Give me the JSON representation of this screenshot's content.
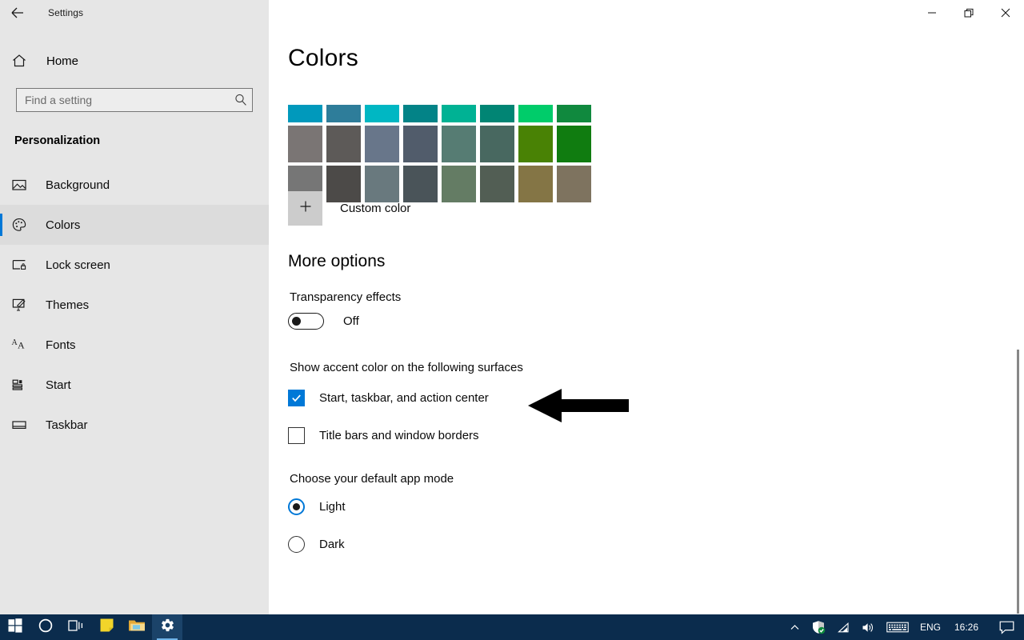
{
  "window": {
    "title": "Settings",
    "back_icon": "back-arrow-icon",
    "controls": [
      {
        "name": "minimize",
        "label": "Minimize"
      },
      {
        "name": "restore",
        "label": "Restore"
      },
      {
        "name": "close",
        "label": "Close"
      }
    ]
  },
  "sidebar": {
    "home_label": "Home",
    "home_icon": "home-icon",
    "search": {
      "placeholder": "Find a setting",
      "value": "",
      "icon": "search-icon"
    },
    "category": "Personalization",
    "items": [
      {
        "label": "Background",
        "icon": "picture-icon",
        "selected": false
      },
      {
        "label": "Colors",
        "icon": "palette-icon",
        "selected": true
      },
      {
        "label": "Lock screen",
        "icon": "lock-screen-icon",
        "selected": false
      },
      {
        "label": "Themes",
        "icon": "brush-icon",
        "selected": false
      },
      {
        "label": "Fonts",
        "icon": "font-icon",
        "selected": false
      },
      {
        "label": "Start",
        "icon": "start-tiles-icon",
        "selected": false
      },
      {
        "label": "Taskbar",
        "icon": "taskbar-icon",
        "selected": false
      }
    ]
  },
  "main": {
    "page_title": "Colors",
    "accent_color": "#0078d7",
    "swatch_rows": [
      {
        "clipped": true,
        "colors": [
          "#0099bc",
          "#2e7d9a",
          "#00b7c3",
          "#038387",
          "#00b294",
          "#018574",
          "#00cc6a",
          "#10893e"
        ]
      },
      {
        "clipped": false,
        "colors": [
          "#7a7574",
          "#5d5a58",
          "#68768a",
          "#515c6b",
          "#567c73",
          "#486860",
          "#498205",
          "#107c10"
        ]
      },
      {
        "clipped": false,
        "colors": [
          "#767676",
          "#4c4a48",
          "#69797e",
          "#4a5459",
          "#647c64",
          "#525e54",
          "#847545",
          "#7e735f"
        ]
      }
    ],
    "custom_color": {
      "label": "Custom color",
      "icon": "plus-icon"
    },
    "more_options_heading": "More options",
    "transparency": {
      "label": "Transparency effects",
      "state": "Off",
      "on": false
    },
    "accent_surfaces_label": "Show accent color on the following surfaces",
    "checkboxes": [
      {
        "label": "Start, taskbar, and action center",
        "checked": true
      },
      {
        "label": "Title bars and window borders",
        "checked": false
      }
    ],
    "app_mode_heading": "Choose your default app mode",
    "app_modes": [
      {
        "label": "Light",
        "selected": true
      },
      {
        "label": "Dark",
        "selected": false
      }
    ],
    "annotation": {
      "name": "pointer-arrow",
      "direction": "left"
    }
  },
  "taskbar": {
    "background": "#0b2c4d",
    "items": [
      {
        "name": "start-button",
        "icon": "windows-logo-icon"
      },
      {
        "name": "cortana-search",
        "icon": "circle-icon"
      },
      {
        "name": "task-view",
        "icon": "task-view-icon"
      },
      {
        "name": "sticky-notes",
        "icon": "sticky-note-icon"
      },
      {
        "name": "file-explorer",
        "icon": "folder-icon"
      },
      {
        "name": "settings",
        "icon": "gear-icon",
        "active": true
      }
    ],
    "tray": {
      "chevron": "chevron-up-icon",
      "defender": "shield-icon",
      "network": "wifi-icon",
      "volume": "speaker-icon",
      "keyboard": "keyboard-icon",
      "language": "ENG",
      "clock": "16:26",
      "action_center": "speech-bubble-icon"
    }
  }
}
